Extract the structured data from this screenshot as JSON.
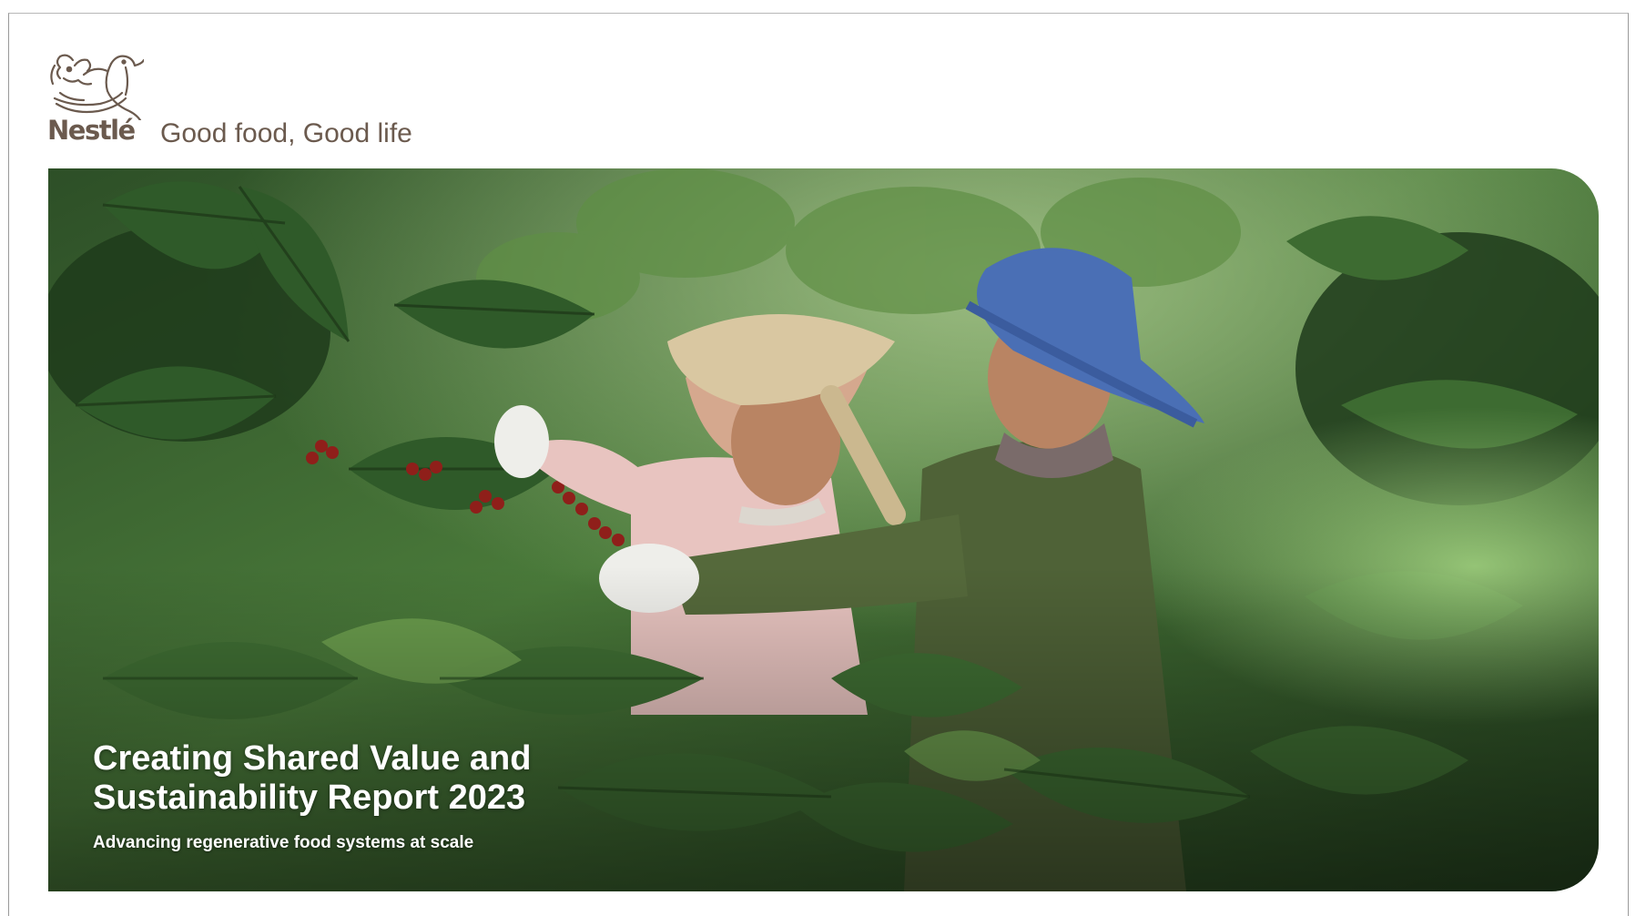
{
  "brand": {
    "wordmark": "Nestlé",
    "tagline": "Good food, Good life",
    "logo_icon": "bird-nest-logo-icon",
    "brand_color": "#6b5a4e"
  },
  "cover": {
    "title_line1": "Creating Shared Value and",
    "title_line2": "Sustainability Report 2023",
    "subtitle": "Advancing regenerative food systems at scale",
    "photo_icon": "coffee-harvest-photo"
  },
  "colors": {
    "foliage_dark": "#1e3a1c",
    "foliage": "#3f6e33",
    "foliage_light": "#7fae5c",
    "blue_hat": "#4a6fb5",
    "straw_hat": "#d9c7a1",
    "pink_jacket": "#e8c4c0",
    "green_shirt": "#4f6237",
    "coffee_cherry": "#8f1f1a"
  }
}
